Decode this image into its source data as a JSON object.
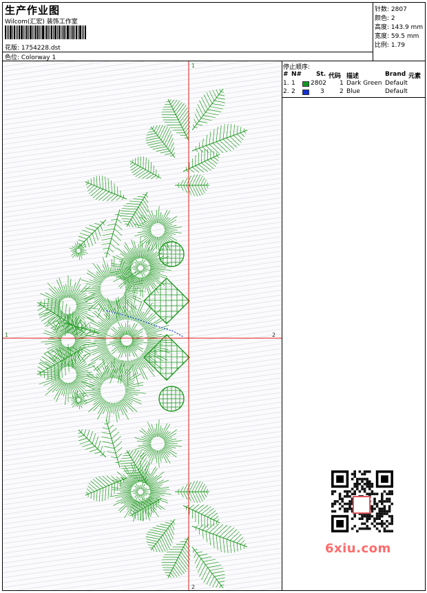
{
  "header": {
    "title": "生产作业图",
    "company": "Wilcom(汇宏) 装饰工作室",
    "design_label": "花版:",
    "design_value": "1754228.dst",
    "color_label": "色位:",
    "color_value": "Colorway 1"
  },
  "stats": [
    {
      "label": "针数:",
      "value": "2807"
    },
    {
      "label": "颜色:",
      "value": "2"
    },
    {
      "label": "高度:",
      "value": "143.9 mm"
    },
    {
      "label": "宽度:",
      "value": "59.5 mm"
    },
    {
      "label": "比例:",
      "value": "1.79"
    }
  ],
  "axis_labels": {
    "top": "1",
    "bottom": "2",
    "left": "1",
    "right": "2"
  },
  "stop_sequence": {
    "label": "停止顺序:",
    "columns": [
      "#",
      "N#",
      "St.",
      "代码",
      "描述",
      "Brand",
      "元素"
    ],
    "rows": [
      {
        "num": "1.",
        "n": "1",
        "color": "#119a21",
        "st": "2802",
        "code": "1",
        "desc": "Dark Green",
        "brand": "Default"
      },
      {
        "num": "2.",
        "n": "2",
        "color": "#1030d8",
        "st": "3",
        "code": "2",
        "desc": "Blue",
        "brand": "Default"
      }
    ]
  },
  "colors": {
    "thread_green": "#1f9a1f",
    "thread_blue": "#1a3fd0",
    "axis": "#e01818"
  },
  "watermark": {
    "text": "6xiu.com",
    "seal_icon": "red-seal-icon"
  }
}
